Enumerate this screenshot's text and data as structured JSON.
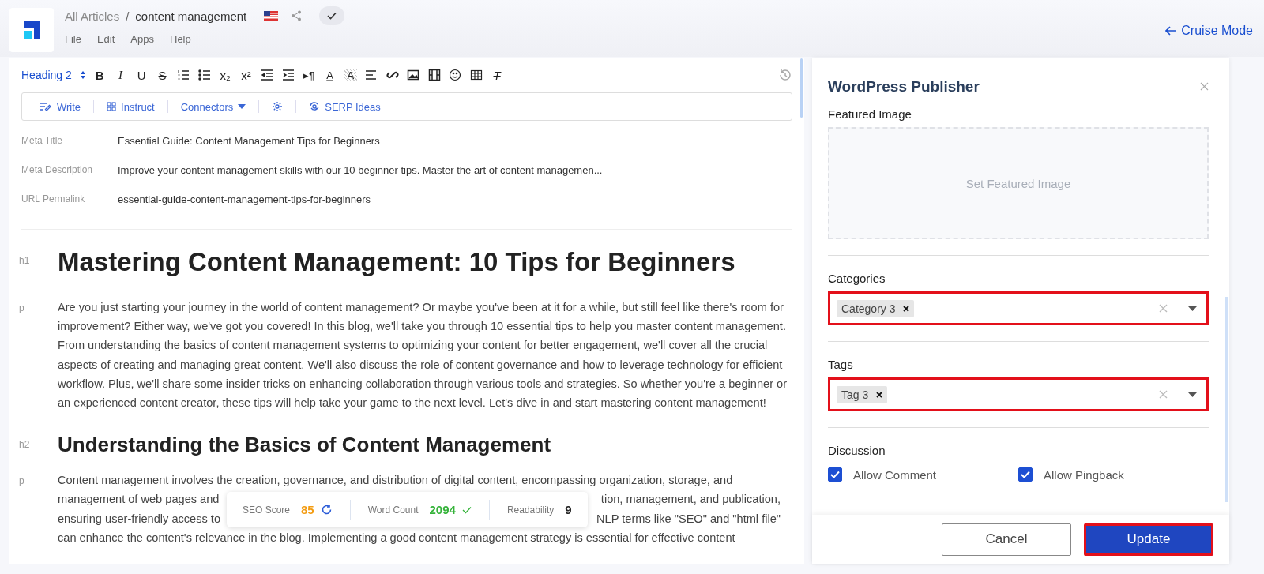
{
  "header": {
    "breadcrumb": {
      "parent": "All Articles",
      "separator": "/",
      "current": "content management"
    },
    "menu": [
      "File",
      "Edit",
      "Apps",
      "Help"
    ],
    "cruise_mode": "Cruise Mode"
  },
  "toolbar": {
    "block_format": "Heading 2",
    "buttons": [
      {
        "kind": "bold",
        "glyph": "B"
      },
      {
        "kind": "italic",
        "glyph": "I"
      },
      {
        "kind": "underline",
        "glyph": "U"
      },
      {
        "kind": "strike",
        "glyph": "S"
      },
      {
        "kind": "ordered-list"
      },
      {
        "kind": "bullet-list"
      },
      {
        "kind": "sub",
        "glyph": "x₂"
      },
      {
        "kind": "sup",
        "glyph": "x²"
      },
      {
        "kind": "outdent"
      },
      {
        "kind": "indent"
      },
      {
        "kind": "para",
        "glyph": "▸¶"
      },
      {
        "kind": "color",
        "glyph": "A"
      },
      {
        "kind": "highlight",
        "glyph": "A"
      },
      {
        "kind": "align"
      },
      {
        "kind": "link"
      },
      {
        "kind": "image"
      },
      {
        "kind": "video"
      },
      {
        "kind": "emoji"
      },
      {
        "kind": "table"
      },
      {
        "kind": "clear",
        "glyph": "T"
      }
    ]
  },
  "ai_bar": [
    {
      "kind": "write",
      "label": "Write"
    },
    {
      "kind": "instruct",
      "label": "Instruct"
    },
    {
      "kind": "connectors",
      "label": "Connectors"
    },
    {
      "kind": "settings"
    },
    {
      "kind": "serp",
      "label": "SERP Ideas"
    }
  ],
  "meta": [
    {
      "label": "Meta Title",
      "value": "Essential Guide: Content Management Tips for Beginners"
    },
    {
      "label": "Meta Description",
      "value": "Improve your content management skills with our 10 beginner tips. Master the art of content managemen..."
    },
    {
      "label": "URL Permalink",
      "value": "essential-guide-content-management-tips-for-beginners"
    }
  ],
  "blocks": [
    {
      "kind": "h1",
      "tag": "h1",
      "text": "Mastering Content Management: 10 Tips for Beginners"
    },
    {
      "kind": "p",
      "tag": "p",
      "text": "Are you just starting your journey in the world of content management? Or maybe you've been at it for a while, but still feel like there's room for improvement? Either way, we've got you covered! In this blog, we'll take you through 10 essential tips to help you master content management. From understanding the basics of content management systems to optimizing your content for better engagement, we'll cover all the crucial aspects of creating and managing great content. We'll also discuss the role of content governance and how to leverage technology for efficient workflow. Plus, we'll share some insider tricks on enhancing collaboration through various tools and strategies. So whether you're a beginner or an experienced content creator, these tips will help take your game to the next level. Let's dive in and start mastering content management!"
    },
    {
      "kind": "h2",
      "tag": "h2",
      "text": "Understanding the Basics of Content Management"
    },
    {
      "kind": "split",
      "tag": "p",
      "lines": [
        [
          "Content management involves the creation, governance, and distribution of digital content, encompassing organization, storage, and"
        ],
        [
          "management of web pages and",
          "tion, management, and publication,"
        ],
        [
          "ensuring user-friendly access to",
          "NLP terms like \"SEO\" and \"html file\""
        ],
        [
          "can enhance the content's relevance in the blog. Implementing a good content management strategy is essential for effective content"
        ]
      ]
    }
  ],
  "stats": [
    {
      "label": "SEO Score",
      "value": "85",
      "kind": "score"
    },
    {
      "label": "Word Count",
      "value": "2094",
      "kind": "count"
    },
    {
      "label": "Readability",
      "value": "9",
      "kind": "plain"
    }
  ],
  "publisher": {
    "title": "WordPress Publisher",
    "featured_image": {
      "label": "Featured Image",
      "placeholder": "Set Featured Image"
    },
    "selects": [
      {
        "label": "Categories",
        "chips": [
          "Category 3"
        ]
      },
      {
        "label": "Tags",
        "chips": [
          "Tag 3"
        ]
      }
    ],
    "discussion": {
      "label": "Discussion",
      "options": [
        {
          "label": "Allow Comment",
          "checked": true
        },
        {
          "label": "Allow Pingback",
          "checked": true
        }
      ]
    },
    "buttons": [
      {
        "kind": "secondary",
        "label": "Cancel"
      },
      {
        "kind": "primary",
        "label": "Update"
      }
    ]
  }
}
